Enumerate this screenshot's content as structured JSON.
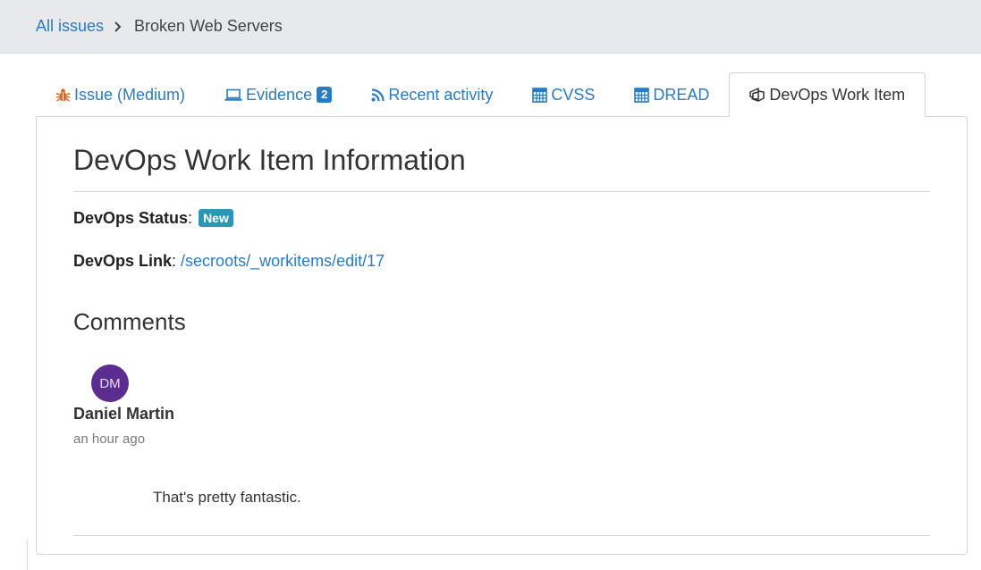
{
  "breadcrumb": {
    "root": "All issues",
    "current": "Broken Web Servers"
  },
  "tabs": [
    {
      "label": "Issue (Medium)",
      "icon": "bug-icon"
    },
    {
      "label": "Evidence",
      "icon": "laptop-icon",
      "count": "2"
    },
    {
      "label": "Recent activity",
      "icon": "rss-icon"
    },
    {
      "label": "CVSS",
      "icon": "calculator-icon"
    },
    {
      "label": "DREAD",
      "icon": "calculator-icon"
    },
    {
      "label": "DevOps Work Item",
      "icon": "azure-devops-icon",
      "active": true
    }
  ],
  "panel": {
    "title": "DevOps Work Item Information",
    "status_label": "DevOps Status",
    "status_value": "New",
    "link_label": "DevOps Link",
    "link_value": "/secroots/_workitems/edit/17"
  },
  "comments": {
    "title": "Comments",
    "items": [
      {
        "initials": "DM",
        "author": "Daniel Martin",
        "time": "an hour ago",
        "text": "That's pretty fantastic."
      }
    ]
  },
  "colors": {
    "link": "#2a7bc0",
    "bug_icon": "#e8641e",
    "status_badge": "#2b96b6",
    "avatar": "#5c2d91",
    "breadcrumb_bg": "#e7e9ec"
  }
}
